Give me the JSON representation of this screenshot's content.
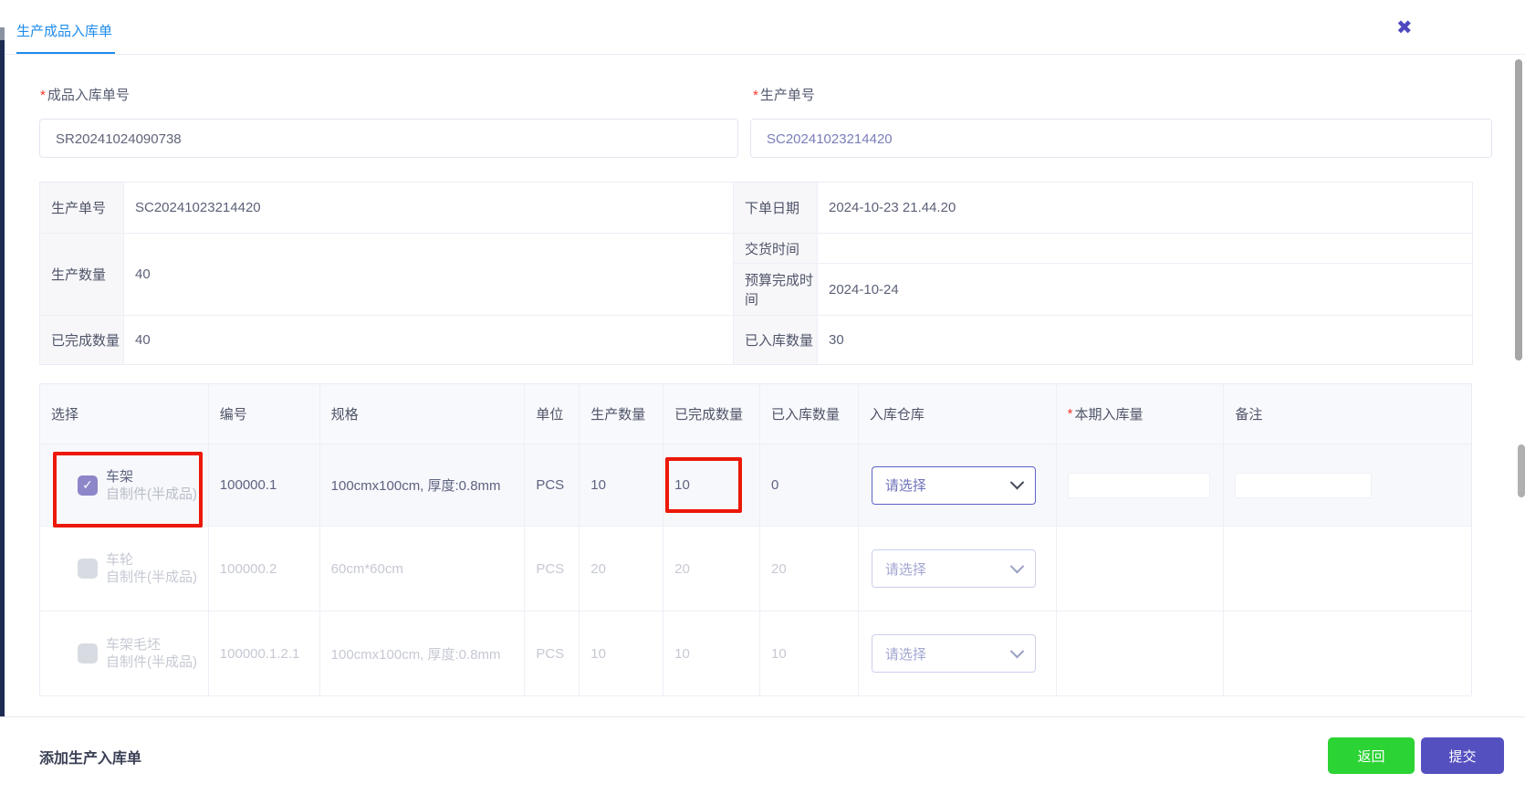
{
  "colors": {
    "accent_blue": "#1e8ceb",
    "accent_purple": "#5550c0",
    "accent_green": "#2bd334",
    "annotation_red": "#ec1808",
    "checkbox_purple": "#8d86c9"
  },
  "icons": {
    "close": "✖",
    "check": "✓",
    "chevron_down": "⌄"
  },
  "required_mark": "*",
  "header": {
    "tab_title": "生产成品入库单"
  },
  "form": {
    "receipt_no": {
      "label": "成品入库单号",
      "value": "SR20241024090738"
    },
    "production_no": {
      "label": "生产单号",
      "value": "SC20241023214420"
    }
  },
  "order_info": {
    "left": [
      {
        "label": "生产单号",
        "value": "SC20241023214420"
      },
      {
        "label": "生产数量",
        "value": "40"
      },
      {
        "label": "已完成数量",
        "value": "40"
      }
    ],
    "right": [
      {
        "label": "下单日期",
        "value": "2024-10-23 21.44.20"
      },
      {
        "label": "交货时间",
        "value": ""
      },
      {
        "label": "预算完成时间",
        "value": "2024-10-24"
      },
      {
        "label": "已入库数量",
        "value": "30"
      }
    ]
  },
  "product_table": {
    "headers": {
      "select": "选择",
      "code": "编号",
      "spec": "规格",
      "unit": "单位",
      "prod_qty": "生产数量",
      "done_qty": "已完成数量",
      "stored_qty": "已入库数量",
      "warehouse": "入库仓库",
      "current_qty": "本期入库量",
      "remark": "备注"
    },
    "rows": [
      {
        "checked": true,
        "name": "车架",
        "category": "自制件(半成品)",
        "code": "100000.1",
        "spec": "100cmx100cm, 厚度:0.8mm",
        "unit": "PCS",
        "prod_qty": "10",
        "done_qty": "10",
        "stored_qty": "0",
        "warehouse_placeholder": "请选择",
        "current_qty_value": "",
        "remark_value": ""
      },
      {
        "checked": false,
        "name": "车轮",
        "category": "自制件(半成品)",
        "code": "100000.2",
        "spec": "60cm*60cm",
        "unit": "PCS",
        "prod_qty": "20",
        "done_qty": "20",
        "stored_qty": "20",
        "warehouse_placeholder": "请选择"
      },
      {
        "checked": false,
        "name": "车架毛坯",
        "category": "自制件(半成品)",
        "code": "100000.1.2.1",
        "spec": "100cmx100cm, 厚度:0.8mm",
        "unit": "PCS",
        "prod_qty": "10",
        "done_qty": "10",
        "stored_qty": "10",
        "warehouse_placeholder": "请选择"
      }
    ]
  },
  "footer": {
    "add_link": "添加生产入库单",
    "back_button": "返回",
    "submit_button": "提交"
  }
}
